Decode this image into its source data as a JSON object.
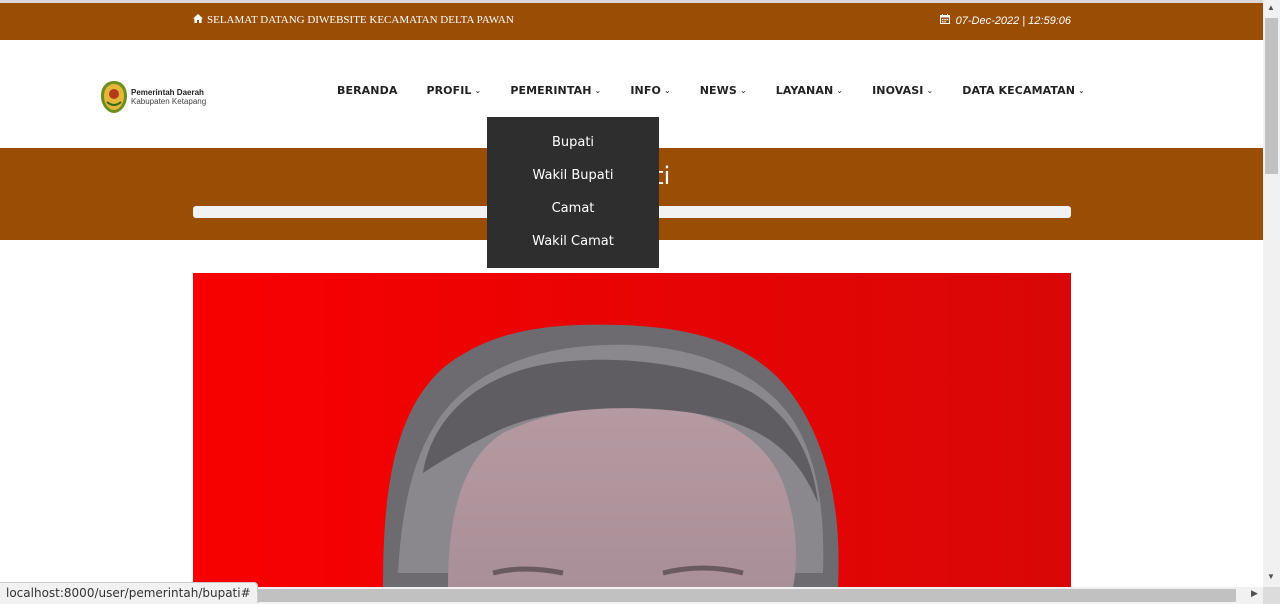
{
  "topbar": {
    "welcome_icon": "home-icon",
    "welcome": "SELAMAT DATANG DIWEBSITE KECAMATAN DELTA PAWAN",
    "date_icon": "calendar-icon",
    "datetime": "07-Dec-2022 | 12:59:06",
    "bg_color": "#9a4e05"
  },
  "logo": {
    "line1": "Pemerintah Daerah",
    "line2": "Kabupaten Ketapang"
  },
  "nav": {
    "items": [
      {
        "label": "BERANDA"
      },
      {
        "label": "PROFIL"
      },
      {
        "label": "PEMERINTAH"
      },
      {
        "label": "INFO"
      },
      {
        "label": "NEWS"
      },
      {
        "label": "LAYANAN"
      },
      {
        "label": "INOVASI"
      },
      {
        "label": "DATA KECAMATAN"
      }
    ],
    "chevron": "⌄"
  },
  "dropdown": {
    "items": [
      "Bupati",
      "Wakil Bupati",
      "Camat",
      "Wakil Camat"
    ]
  },
  "hero": {
    "title": "Bupati"
  },
  "status_url": "localhost:8000/user/pemerintah/bupati#"
}
